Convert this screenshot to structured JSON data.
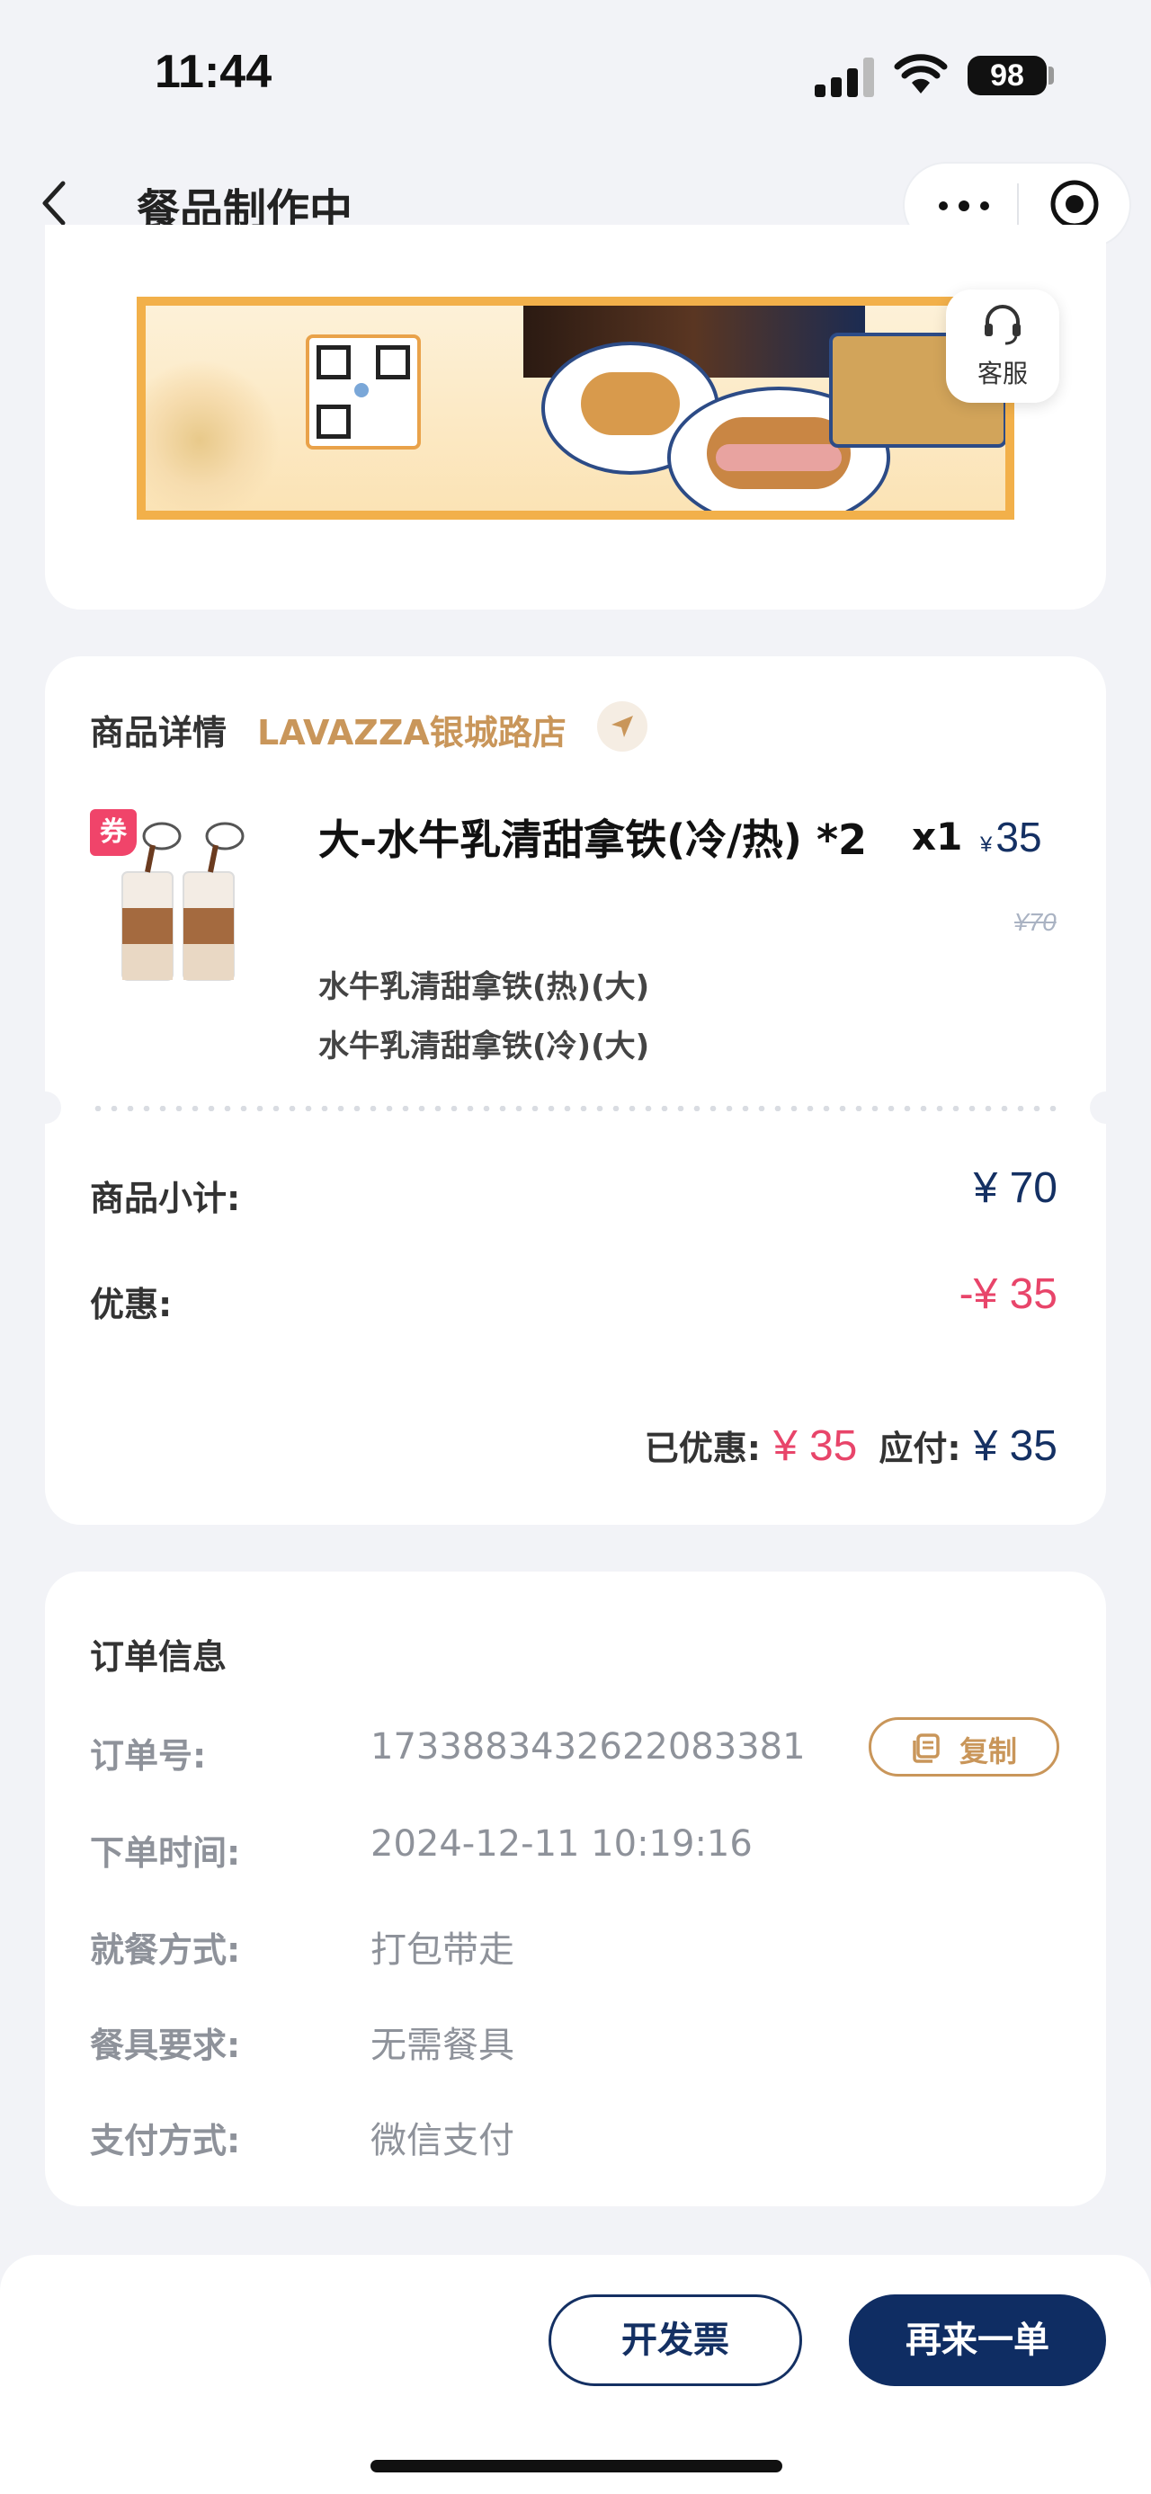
{
  "status_bar": {
    "time": "11:44",
    "battery": "98"
  },
  "nav": {
    "title": "餐品制作中"
  },
  "customer_service": {
    "label": "客服"
  },
  "product_detail": {
    "section_title": "商品详情",
    "store_name": "LAVAZZA银城路店",
    "coupon_tag": "券",
    "item": {
      "name": "大-水牛乳清甜拿铁(冷/热) *2",
      "qty": "x1",
      "currency": "¥",
      "price": "35",
      "original_price": "¥70",
      "specs": [
        "水牛乳清甜拿铁(热)(大)",
        "水牛乳清甜拿铁(冷)(大)"
      ]
    },
    "subtotal_label": "商品小计:",
    "subtotal_value": "¥ 70",
    "discount_label": "优惠:",
    "discount_value": "-¥ 35",
    "saved_label": "已优惠:",
    "saved_value": "¥ 35",
    "payable_label": "应付:",
    "payable_value": "¥ 35"
  },
  "order_info": {
    "section_title": "订单信息",
    "copy_label": "复制",
    "rows": [
      {
        "label": "订单号:",
        "value": "1733883432622083381"
      },
      {
        "label": "下单时间:",
        "value": "2024-12-11 10:19:16"
      },
      {
        "label": "就餐方式:",
        "value": "打包带走"
      },
      {
        "label": "餐具要求:",
        "value": "无需餐具"
      },
      {
        "label": "支付方式:",
        "value": "微信支付"
      }
    ]
  },
  "actions": {
    "invoice_label": "开发票",
    "reorder_label": "再来一单"
  },
  "colors": {
    "navy": "#143063",
    "accent_gold": "#c9965a",
    "discount_red": "#e8456a"
  }
}
